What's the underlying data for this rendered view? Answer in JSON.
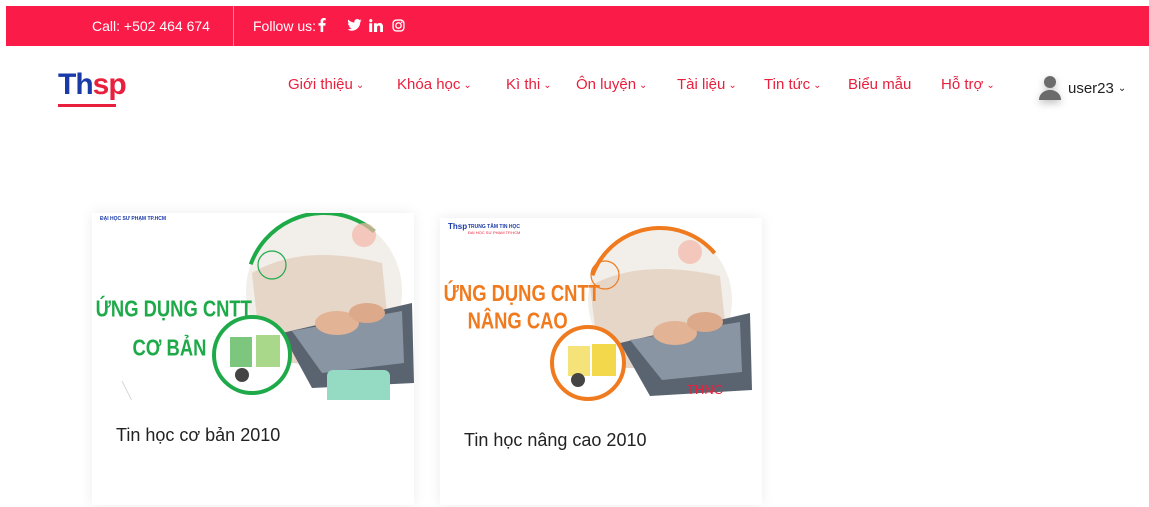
{
  "topbar": {
    "call": "Call: +502 464 674",
    "follow": "Follow us:",
    "social": [
      {
        "icon": "facebook-icon"
      },
      {
        "icon": "twitter-icon"
      },
      {
        "icon": "linkedin-icon"
      },
      {
        "icon": "instagram-icon"
      }
    ],
    "bg_color": "#fb1b49"
  },
  "logo": {
    "text_a": "Th",
    "text_b": "sp"
  },
  "nav": [
    {
      "label": "Giới thiệu",
      "has_dropdown": true
    },
    {
      "label": "Khóa học",
      "has_dropdown": true
    },
    {
      "label": "Kì thi",
      "has_dropdown": true
    },
    {
      "label": "Ôn luyện",
      "has_dropdown": true
    },
    {
      "label": "Tài liệu",
      "has_dropdown": true
    },
    {
      "label": "Tin tức",
      "has_dropdown": true
    },
    {
      "label": "Biểu mẫu",
      "has_dropdown": false
    },
    {
      "label": "Hỗ trợ",
      "has_dropdown": true
    }
  ],
  "user": {
    "name": "user23"
  },
  "courses": [
    {
      "title": "Tin học cơ bản 2010",
      "image_heading_1": "ỨNG DỤNG CNTT",
      "image_heading_2": "CƠ BẢN",
      "image_header": "ĐẠI HỌC SƯ PHẠM TP.HCM",
      "accent": "#1faa4a",
      "badge": ""
    },
    {
      "title": "Tin học nâng cao 2010",
      "image_heading_1": "ỨNG DỤNG CNTT",
      "image_heading_2": "NÂNG CAO",
      "image_header": "TRUNG TÂM TIN HỌC",
      "image_subheader": "ĐẠI HỌC SƯ PHẠM TP.HCM",
      "accent": "#f07a1e",
      "badge": "THNC"
    }
  ],
  "colors": {
    "brand_red": "#e8203d",
    "brand_blue": "#1a3aa8"
  }
}
